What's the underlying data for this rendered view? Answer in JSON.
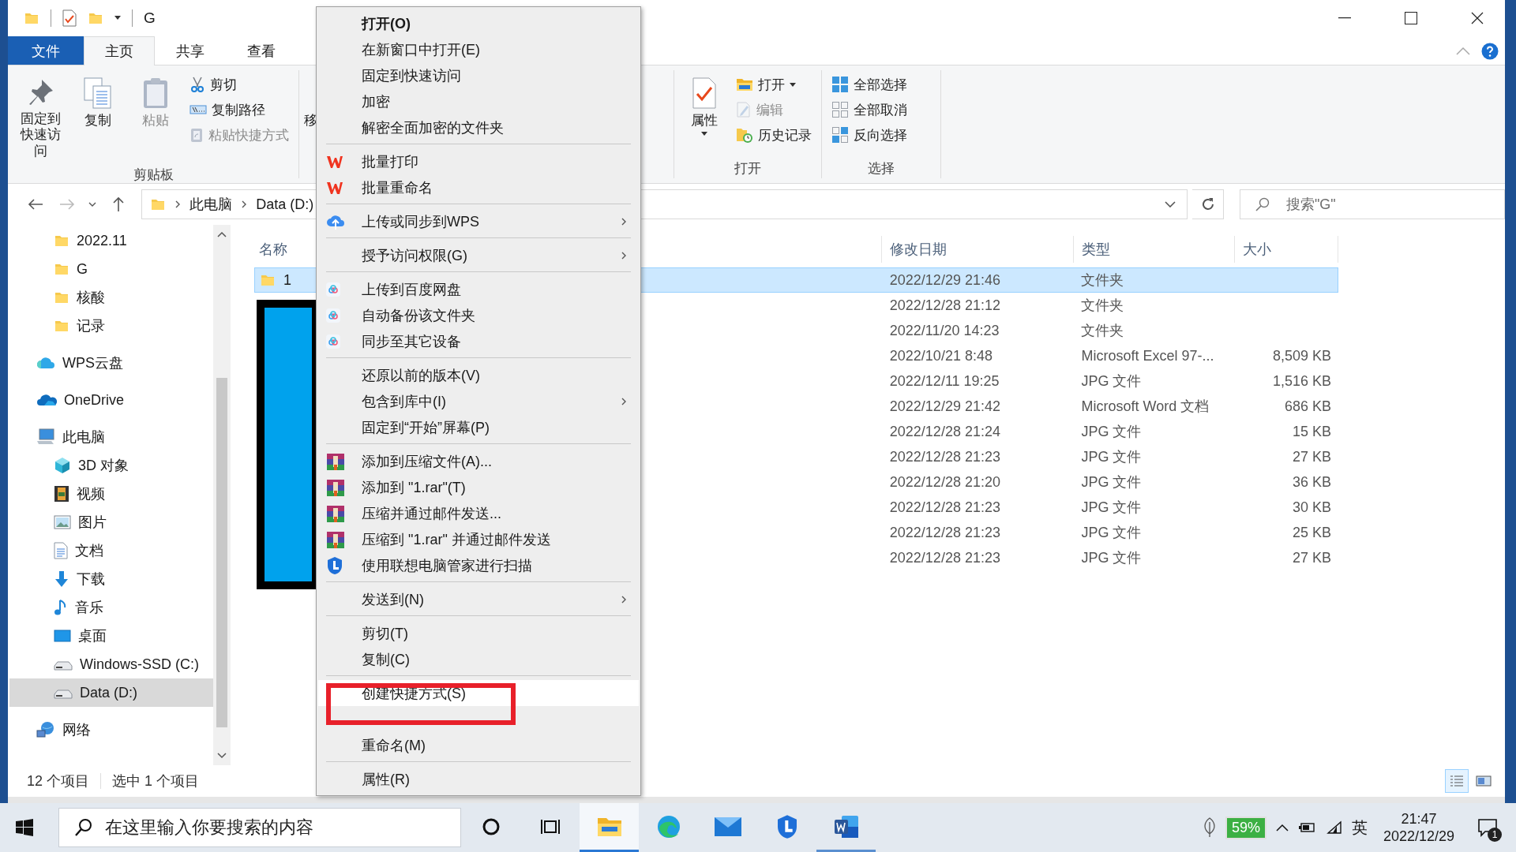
{
  "window": {
    "title": "G"
  },
  "ribbon": {
    "tabs": [
      {
        "label": "文件",
        "kind": "file",
        "selected": false
      },
      {
        "label": "主页",
        "kind": "tab",
        "selected": true
      },
      {
        "label": "共享",
        "kind": "tab",
        "selected": false
      },
      {
        "label": "查看",
        "kind": "tab",
        "selected": false
      }
    ],
    "groups": [
      {
        "label": "剪贴板",
        "items": [
          {
            "kind": "pin",
            "label": "固定到快速访问",
            "disabled": false
          },
          {
            "kind": "copy",
            "label": "复制",
            "disabled": false
          },
          {
            "kind": "paste",
            "label": "粘贴",
            "disabled": true
          },
          {
            "kind": "cut",
            "label": "剪切",
            "disabled": false
          },
          {
            "kind": "copy-path",
            "label": "复制路径",
            "disabled": false
          },
          {
            "kind": "paste-shortcut",
            "label": "粘贴快捷方式",
            "disabled": true
          }
        ]
      },
      {
        "items": [
          {
            "kind": "move",
            "label": "移"
          }
        ]
      },
      {
        "label": "打开",
        "items": [
          {
            "kind": "properties",
            "label": "属性",
            "disabled": false
          },
          {
            "kind": "open",
            "label": "打开",
            "disabled": false
          },
          {
            "kind": "edit",
            "label": "编辑",
            "disabled": true
          },
          {
            "kind": "history",
            "label": "历史记录",
            "disabled": false
          }
        ]
      },
      {
        "label": "选择",
        "items": [
          {
            "kind": "select-all",
            "label": "全部选择",
            "disabled": false
          },
          {
            "kind": "select-none",
            "label": "全部取消",
            "disabled": false
          },
          {
            "kind": "invert",
            "label": "反向选择",
            "disabled": false
          }
        ]
      }
    ]
  },
  "address": {
    "path": [
      "此电脑",
      "Data (D:)"
    ],
    "search": {
      "placeholder": "搜索\"G\""
    }
  },
  "nav": {
    "items": [
      {
        "label": "2022.11",
        "kind": "folder",
        "selected": false
      },
      {
        "label": "G",
        "kind": "folder",
        "selected": false
      },
      {
        "label": "核酸",
        "kind": "folder",
        "selected": false
      },
      {
        "label": "记录",
        "kind": "folder",
        "selected": false
      },
      {
        "label": "WPS云盘",
        "kind": "wps-cloud",
        "selected": false
      },
      {
        "label": "OneDrive",
        "kind": "onedrive",
        "selected": false
      },
      {
        "label": "此电脑",
        "kind": "pc",
        "selected": false,
        "children": [
          {
            "label": "3D 对象",
            "kind": "cube",
            "selected": false
          },
          {
            "label": "视频",
            "kind": "video",
            "selected": false
          },
          {
            "label": "图片",
            "kind": "picture",
            "selected": false
          },
          {
            "label": "文档",
            "kind": "document",
            "selected": false
          },
          {
            "label": "下载",
            "kind": "download",
            "selected": false
          },
          {
            "label": "音乐",
            "kind": "music",
            "selected": false
          },
          {
            "label": "桌面",
            "kind": "desktop",
            "selected": false
          },
          {
            "label": "Windows-SSD (C:)",
            "kind": "drive",
            "selected": false
          },
          {
            "label": "Data (D:)",
            "kind": "drive",
            "selected": true
          }
        ]
      },
      {
        "label": "网络",
        "kind": "network",
        "selected": false
      }
    ]
  },
  "file_list": {
    "columns": [
      "名称",
      "修改日期",
      "类型",
      "大小"
    ],
    "rows": [
      {
        "name": "1",
        "modified": "2022/12/29 21:46",
        "type": "文件夹",
        "selected": true
      },
      {
        "modified": "2022/12/28 21:12",
        "type": "文件夹",
        "selected": false
      },
      {
        "modified": "2022/11/20 14:23",
        "type": "文件夹",
        "selected": false
      },
      {
        "modified": "2022/10/21 8:48",
        "type": "Microsoft Excel 97-...",
        "size": "8,509 KB",
        "selected": false
      },
      {
        "modified": "2022/12/11 19:25",
        "type": "JPG 文件",
        "size": "1,516 KB",
        "selected": false
      },
      {
        "modified": "2022/12/29 21:42",
        "type": "Microsoft Word 文档",
        "size": "686 KB",
        "selected": false
      },
      {
        "modified": "2022/12/28 21:24",
        "type": "JPG 文件",
        "size": "15 KB",
        "selected": false
      },
      {
        "modified": "2022/12/28 21:23",
        "type": "JPG 文件",
        "size": "27 KB",
        "selected": false
      },
      {
        "modified": "2022/12/28 21:20",
        "type": "JPG 文件",
        "size": "36 KB",
        "selected": false
      },
      {
        "modified": "2022/12/28 21:23",
        "type": "JPG 文件",
        "size": "30 KB",
        "selected": false
      },
      {
        "modified": "2022/12/28 21:23",
        "type": "JPG 文件",
        "size": "25 KB",
        "selected": false
      },
      {
        "modified": "2022/12/28 21:23",
        "type": "JPG 文件",
        "size": "27 KB",
        "selected": false
      }
    ]
  },
  "context_menu": {
    "groups": [
      {
        "items": [
          {
            "label": "打开(O)",
            "kind": "plain",
            "default": true,
            "submenu": false,
            "selected": false
          },
          {
            "label": "在新窗口中打开(E)",
            "kind": "plain",
            "default": false,
            "submenu": false,
            "selected": false
          },
          {
            "label": "固定到快速访问",
            "kind": "plain",
            "default": false,
            "submenu": false,
            "selected": false
          },
          {
            "label": "加密",
            "kind": "plain",
            "default": false,
            "submenu": false,
            "selected": false
          },
          {
            "label": "解密全面加密的文件夹",
            "kind": "plain",
            "default": false,
            "submenu": false,
            "selected": false
          }
        ]
      },
      {
        "items": [
          {
            "label": "批量打印",
            "kind": "wps",
            "default": false,
            "submenu": false,
            "selected": false
          },
          {
            "label": "批量重命名",
            "kind": "wps",
            "default": false,
            "submenu": false,
            "selected": false
          }
        ]
      },
      {
        "items": [
          {
            "label": "上传或同步到WPS",
            "kind": "upload",
            "default": false,
            "submenu": true,
            "selected": false
          }
        ]
      },
      {
        "items": [
          {
            "label": "授予访问权限(G)",
            "kind": "plain",
            "default": false,
            "submenu": true,
            "selected": false
          }
        ]
      },
      {
        "items": [
          {
            "label": "上传到百度网盘",
            "kind": "netdisk",
            "default": false,
            "submenu": false,
            "selected": false
          },
          {
            "label": "自动备份该文件夹",
            "kind": "netdisk",
            "default": false,
            "submenu": false,
            "selected": false
          },
          {
            "label": "同步至其它设备",
            "kind": "netdisk",
            "default": false,
            "submenu": false,
            "selected": false
          }
        ]
      },
      {
        "items": [
          {
            "label": "还原以前的版本(V)",
            "kind": "plain",
            "default": false,
            "submenu": false,
            "selected": false
          },
          {
            "label": "包含到库中(I)",
            "kind": "plain",
            "default": false,
            "submenu": true,
            "selected": false
          },
          {
            "label": "固定到“开始”屏幕(P)",
            "kind": "plain",
            "default": false,
            "submenu": false,
            "selected": false
          }
        ]
      },
      {
        "items": [
          {
            "label": "添加到压缩文件(A)...",
            "kind": "archive",
            "default": false,
            "submenu": false,
            "selected": false
          },
          {
            "label": "添加到 \"1.rar\"(T)",
            "kind": "archive",
            "default": false,
            "submenu": false,
            "selected": false
          },
          {
            "label": "压缩并通过邮件发送...",
            "kind": "archive",
            "default": false,
            "submenu": false,
            "selected": false
          },
          {
            "label": "压缩到 \"1.rar\" 并通过邮件发送",
            "kind": "archive",
            "default": false,
            "submenu": false,
            "selected": false
          },
          {
            "label": "使用联想电脑管家进行扫描",
            "kind": "shield",
            "default": false,
            "submenu": false,
            "selected": false
          }
        ]
      },
      {
        "items": [
          {
            "label": "发送到(N)",
            "kind": "plain",
            "default": false,
            "submenu": true,
            "selected": false
          }
        ]
      },
      {
        "items": [
          {
            "label": "剪切(T)",
            "kind": "plain",
            "default": false,
            "submenu": false,
            "selected": false
          },
          {
            "label": "复制(C)",
            "kind": "plain",
            "default": false,
            "submenu": false,
            "selected": false
          }
        ]
      },
      {
        "items": [
          {
            "label": "创建快捷方式(S)",
            "kind": "plain",
            "default": false,
            "submenu": false,
            "selected": true
          },
          {
            "kind": "covered"
          },
          {
            "label": "重命名(M)",
            "kind": "plain",
            "default": false,
            "submenu": false,
            "selected": false
          }
        ]
      },
      {
        "items": [
          {
            "label": "属性(R)",
            "kind": "plain",
            "default": false,
            "submenu": false,
            "selected": false
          }
        ]
      }
    ]
  },
  "status_bar": {
    "count": "12 个项目",
    "selection": "选中 1 个项目",
    "views": [
      {
        "kind": "details",
        "selected": true
      },
      {
        "kind": "tiles",
        "selected": false
      }
    ]
  },
  "taskbar": {
    "search": {
      "placeholder": "在这里输入你要搜索的内容"
    },
    "apps": [
      {
        "kind": "cortana",
        "running": false,
        "active": false
      },
      {
        "kind": "task-view",
        "running": false,
        "active": false
      },
      {
        "kind": "explorer",
        "running": true,
        "active": true
      },
      {
        "kind": "edge",
        "running": false,
        "active": false
      },
      {
        "kind": "mail",
        "running": false,
        "active": false
      },
      {
        "kind": "lenovo",
        "running": false,
        "active": false
      },
      {
        "kind": "word",
        "running": true,
        "active": false
      }
    ],
    "tray": {
      "battery": "59%",
      "input": "英",
      "time": "21:47",
      "date": "2022/12/29",
      "notifications": "1"
    }
  }
}
